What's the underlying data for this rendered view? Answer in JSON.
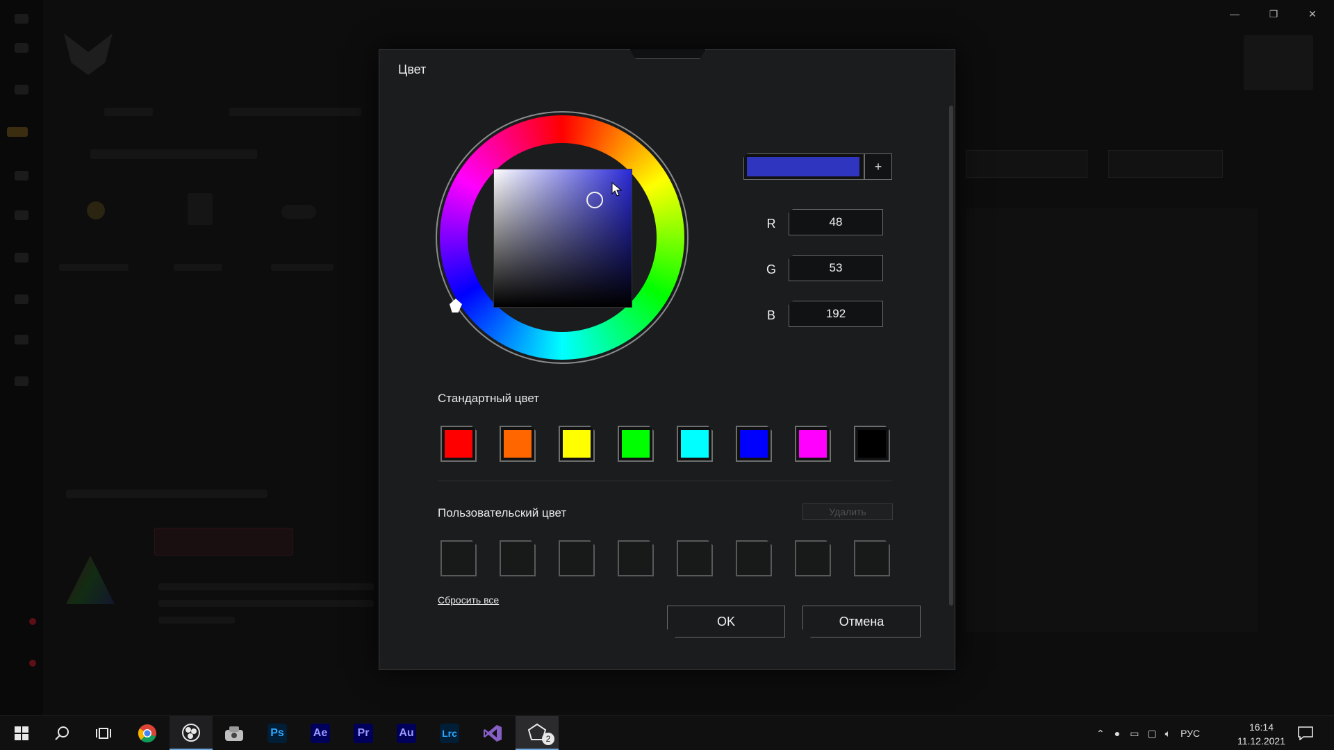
{
  "dialog": {
    "title": "Цвет",
    "current_color": "#3035c0",
    "add_label": "+",
    "rgb": [
      {
        "label": "R",
        "value": "48"
      },
      {
        "label": "G",
        "value": "53"
      },
      {
        "label": "B",
        "value": "192"
      }
    ],
    "standard_label": "Стандартный цвет",
    "standard_colors": [
      "#ff0000",
      "#ff6600",
      "#ffff00",
      "#00ff00",
      "#00ffff",
      "#0000ff",
      "#ff00ff",
      "#000000"
    ],
    "custom_label": "Пользовательский цвет",
    "delete_label": "Удалить",
    "custom_slots": 8,
    "reset_label": "Сбросить все",
    "ok_label": "OK",
    "cancel_label": "Отмена"
  },
  "window_controls": {
    "minimize": "—",
    "restore": "❐",
    "close": "✕"
  },
  "taskbar": {
    "apps": [
      {
        "name": "windows-start",
        "label": ""
      },
      {
        "name": "search",
        "label": ""
      },
      {
        "name": "task-view",
        "label": ""
      },
      {
        "name": "chrome",
        "label": ""
      },
      {
        "name": "obs",
        "label": ""
      },
      {
        "name": "armoury",
        "label": ""
      },
      {
        "name": "photoshop",
        "label": "Ps",
        "color": "#31a8ff",
        "bg": "#001e36"
      },
      {
        "name": "after-effects",
        "label": "Ae",
        "color": "#9999ff",
        "bg": "#00005b"
      },
      {
        "name": "premiere",
        "label": "Pr",
        "color": "#9999ff",
        "bg": "#00005b"
      },
      {
        "name": "audition",
        "label": "Au",
        "color": "#9999ff",
        "bg": "#00005b"
      },
      {
        "name": "lightroom",
        "label": "Lrc",
        "color": "#31a8ff",
        "bg": "#001e36"
      },
      {
        "name": "visual-studio",
        "label": ""
      },
      {
        "name": "aura-creator",
        "label": "",
        "badge": "2"
      }
    ],
    "language": "РУС",
    "time": "16:14",
    "date": "11.12.2021"
  }
}
